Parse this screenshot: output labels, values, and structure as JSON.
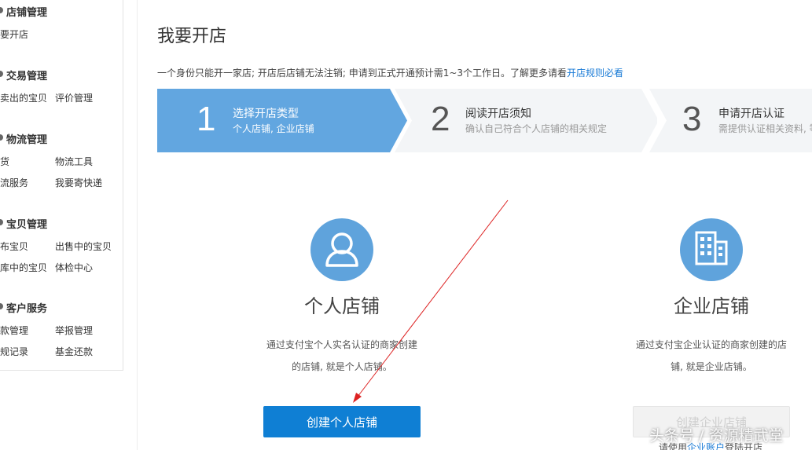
{
  "sidebar": {
    "groups": [
      {
        "title": "店铺管理",
        "links": [
          "要开店"
        ]
      },
      {
        "title": "交易管理",
        "links": [
          "卖出的宝贝",
          "评价管理"
        ]
      },
      {
        "title": "物流管理",
        "links": [
          "货",
          "物流工具",
          "流服务",
          "我要寄快递"
        ]
      },
      {
        "title": "宝贝管理",
        "links": [
          "布宝贝",
          "出售中的宝贝",
          "库中的宝贝",
          "体检中心"
        ]
      },
      {
        "title": "客户服务",
        "links": [
          "款管理",
          "举报管理",
          "规记录",
          "基金还款"
        ]
      }
    ]
  },
  "main": {
    "title": "我要开店",
    "notice_text": "一个身份只能开一家店; 开店后店铺无法注销; 申请到正式开通预计需1~3个工作日。了解更多请看",
    "notice_link": "开店规则必看"
  },
  "steps": [
    {
      "number": "1",
      "title": "选择开店类型",
      "desc": "个人店铺, 企业店铺"
    },
    {
      "number": "2",
      "title": "阅读开店须知",
      "desc": "确认自己符合个人店铺的相关规定"
    },
    {
      "number": "3",
      "title": "申请开店认证",
      "desc": "需提供认证相关资料, 等"
    }
  ],
  "personal": {
    "icon": "person-icon",
    "title": "个人店铺",
    "desc": "通过支付宝个人实名认证的商家创建的店铺, 就是个人店铺。",
    "button": "创建个人店铺"
  },
  "enterprise": {
    "icon": "building-icon",
    "title": "企业店铺",
    "desc": "通过支付宝企业认证的商家创建的店铺, 就是企业店铺。",
    "button": "创建企业店铺",
    "hint_prefix": "请使用",
    "hint_link": "企业账户",
    "hint_suffix": "登陆开店"
  },
  "watermark": "头条号 / 资源精武堂",
  "colors": {
    "accent": "#0f7fd4",
    "step_active": "#62a6e0",
    "step_inactive": "#f3f5f7",
    "icon_circle": "#5fa3dc",
    "link": "#1a7bd6"
  }
}
